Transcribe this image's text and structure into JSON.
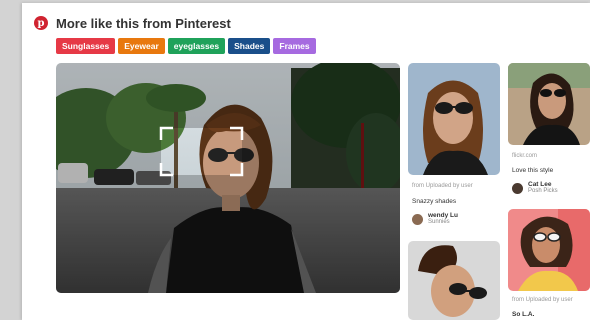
{
  "header": {
    "title": "More like this from Pinterest",
    "logo_glyph": "p"
  },
  "tags": [
    {
      "label": "Sunglasses",
      "color": "#e63946"
    },
    {
      "label": "Eyewear",
      "color": "#e8780e"
    },
    {
      "label": "eyeglasses",
      "color": "#1fa25a"
    },
    {
      "label": "Shades",
      "color": "#1a4f8a"
    },
    {
      "label": "Frames",
      "color": "#a66ae0"
    }
  ],
  "pins": {
    "pin1": {
      "source": "from Uploaded by user",
      "description": "Snazzy shades",
      "user_name": "wendy Lu",
      "user_board": "Sunnies"
    },
    "pin2": {
      "source": "flickr.com",
      "description": "Love this style",
      "user_name": "Cat Lee",
      "user_board": "Posh Picks"
    },
    "pin4": {
      "source": "from Uploaded by user",
      "user_name": "So L.A."
    }
  }
}
